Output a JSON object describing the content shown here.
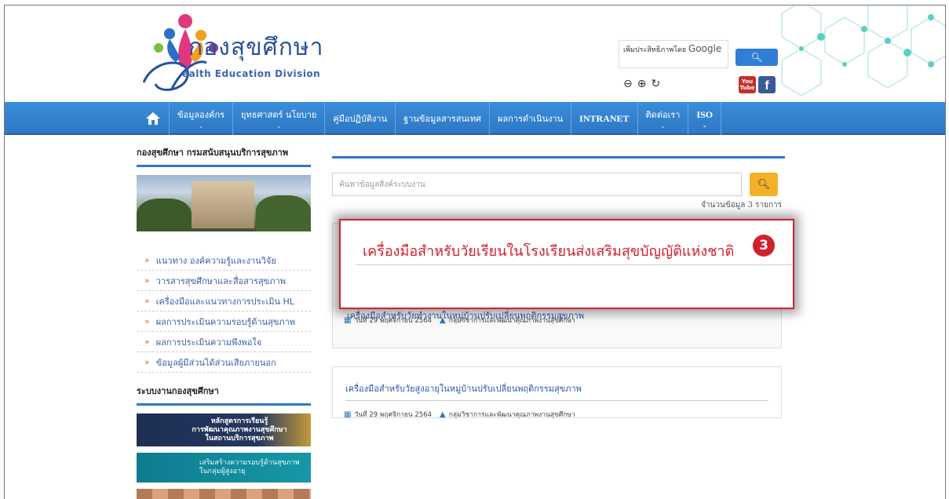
{
  "header": {
    "logo_title": "กองสุขศึกษา",
    "logo_subtitle": "ealth Education Division",
    "google_label_prefix": "เพิ่มประสิทธิภาพโดย",
    "google_label_brand": "Google",
    "search_icon": "magnifier-icon",
    "zoom_out_icon": "zoom-out-icon",
    "zoom_in_icon": "zoom-in-icon",
    "reset_icon": "reset-icon",
    "youtube_label": "You Tube",
    "facebook_label": "f"
  },
  "nav": {
    "home_icon": "home-icon",
    "items": [
      {
        "label": "ข้อมูลองค์กร"
      },
      {
        "label": "ยุทธศาสตร์ นโยบาย"
      },
      {
        "label": "คู่มือปฏิบัติงาน"
      },
      {
        "label": "ฐานข้อมูลสารสนเทศ"
      },
      {
        "label": "ผลการดำเนินงาน"
      },
      {
        "label": "INTRANET"
      },
      {
        "label": "ติดต่อเรา"
      },
      {
        "label": "ISO"
      }
    ],
    "accent_color": "#2f78c4"
  },
  "sidebar": {
    "heading": "กองสุขศึกษา กรมสนับสนุนบริการสุขภาพ",
    "items": [
      {
        "label": "แนวทาง องค์ความรู้และงานวิจัย"
      },
      {
        "label": "วารสารสุขศึกษาและสื่อสารสุขภาพ"
      },
      {
        "label": "เครื่องมือและแนวทางการประเมิน HL"
      },
      {
        "label": "ผลการประเมินความรอบรู้ด้านสุขภาพ"
      },
      {
        "label": "ผลการประเมินความพึงพอใจ"
      },
      {
        "label": "ข้อมูลผู้มีส่วนได้ส่วนเสียภายนอก"
      }
    ],
    "heading2": "ระบบงานกองสุขศึกษา",
    "banner1_line1": "หลักสูตรการเรียนรู้",
    "banner1_line2": "การพัฒนาคุณภาพงานสุขศึกษา",
    "banner1_line3": "ในสถานบริการสุขภาพ",
    "banner2_line1": "เสริมสร้างความรอบรู้ด้านสุขภาพ",
    "banner2_line2": "ในกลุ่มผู้สูงอายุ"
  },
  "main": {
    "search_placeholder": "ค้นหาข้อมูลสิ่งค์ระบบงาน",
    "count_text": "จำนวนข้อมูล 3 รายการ",
    "highlight_title": "เครื่องมือสำหรับวัยเรียนในโรงเรียนส่งเสริมสุขบัญญัติแห่งชาติ",
    "highlight_badge": "3",
    "cards": [
      {
        "title": "เครื่องมือสำหรับวัยทำงานในหมู่บ้านปรับเปลี่ยนพฤติกรรมสุขภาพ",
        "date": "วันที่ 29 พฤศจิกายน 2564",
        "author": "กลุ่มวิชาการและพัฒนาคุณภาพงานสุขศึกษา"
      },
      {
        "title": "เครื่องมือสำหรับวัยสูงอายุในหมู่บ้านปรับเปลี่ยนพฤติกรรมสุขภาพ",
        "date": "วันที่ 29 พฤศจิกายน 2564",
        "author": "กลุ่มวิชาการและพัฒนาคุณภาพงานสุขศึกษา"
      }
    ],
    "highlight_color": "#d0202e"
  }
}
